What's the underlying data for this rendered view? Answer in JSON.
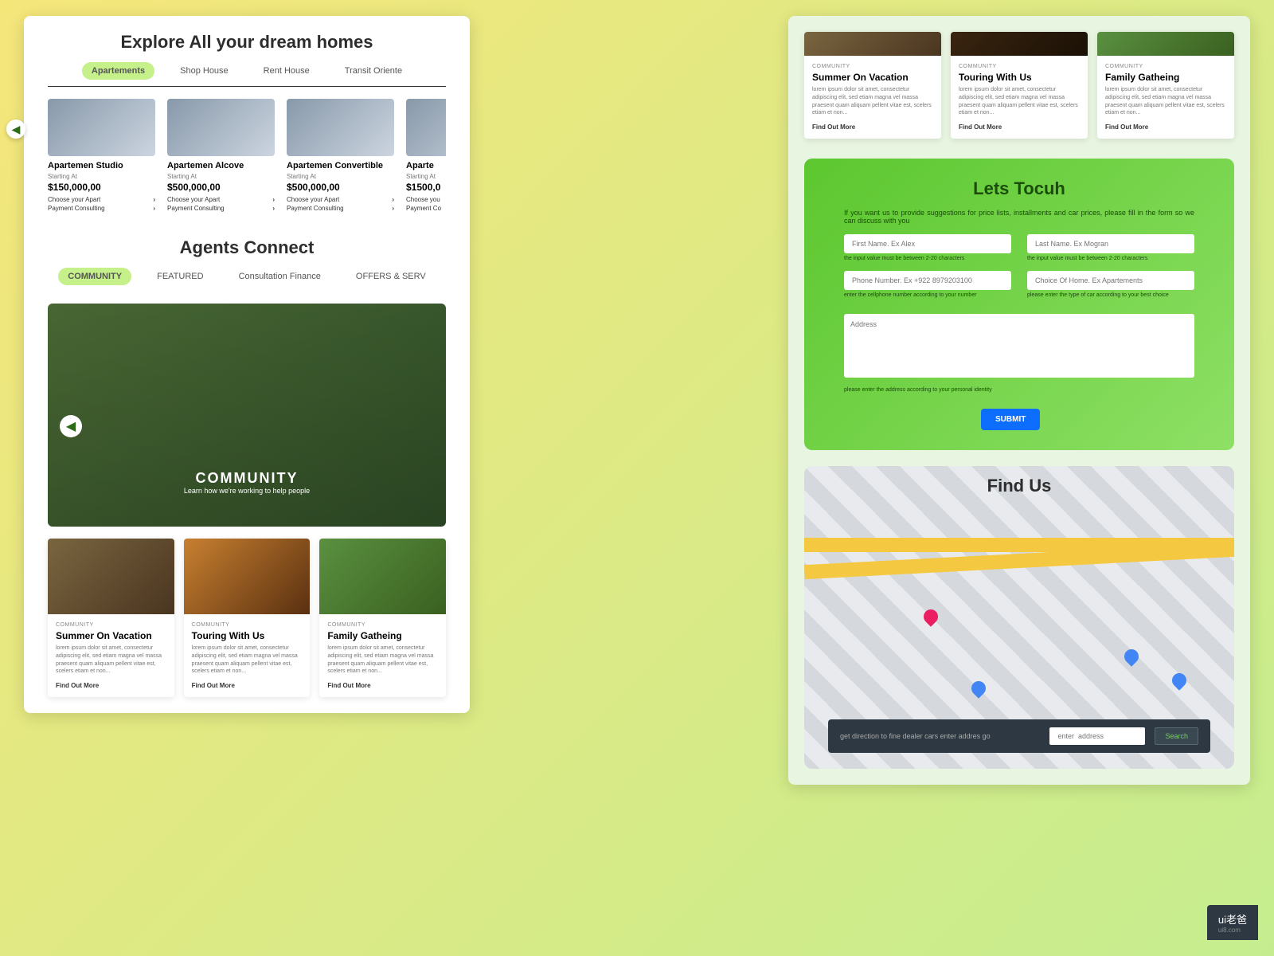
{
  "explore": {
    "title": "Explore All your dream homes",
    "tabs": [
      "Apartements",
      "Shop House",
      "Rent House",
      "Transit Oriente"
    ],
    "listings": [
      {
        "name": "Apartemen Studio",
        "starting": "Starting At",
        "price": "$150,000,00",
        "link1": "Choose your Apart",
        "link2": "Payment Consulting"
      },
      {
        "name": "Apartemen Alcove",
        "starting": "Starting At",
        "price": "$500,000,00",
        "link1": "Choose your Apart",
        "link2": "Payment Consulting"
      },
      {
        "name": "Apartemen Convertible",
        "starting": "Starting At",
        "price": "$500,000,00",
        "link1": "Choose your Apart",
        "link2": "Payment Consulting"
      },
      {
        "name": "Aparte",
        "starting": "Starting At",
        "price": "$1500,0",
        "link1": "Choose you",
        "link2": "Payment Co"
      }
    ]
  },
  "agents": {
    "title": "Agents Connect",
    "tabs": [
      "COMMUNITY",
      "FEATURED",
      "Consultation Finance",
      "OFFERS & SERV"
    ],
    "hero": {
      "title": "COMMUNITY",
      "sub": "Learn how we're working to help people"
    }
  },
  "cards": [
    {
      "tag": "COMMUNITY",
      "title": "Summer On Vacation",
      "desc": "lorem ipsum dolor sit amet, consectetur adipiscing elit, sed etiam magna vel massa praesent quam aliquam pellent vitae est, scelers etiam et non...",
      "link": "Find Out More"
    },
    {
      "tag": "COMMUNITY",
      "title": "Touring With Us",
      "desc": "lorem ipsum dolor sit amet, consectetur adipiscing elit, sed etiam magna vel massa praesent quam aliquam pellent vitae est, scelers etiam et non...",
      "link": "Find Out More"
    },
    {
      "tag": "COMMUNITY",
      "title": "Family Gatheing",
      "desc": "lorem ipsum dolor sit amet, consectetur adipiscing elit, sed etiam magna vel massa praesent quam aliquam pellent vitae est, scelers etiam et non...",
      "link": "Find Out More"
    }
  ],
  "form": {
    "title": "Lets Tocuh",
    "intro": "If you want us to provide suggestions for price lists, installments and car prices, please fill in the form so we can discuss with you",
    "fname_ph": "First Name. Ex Alex",
    "lname_ph": "Last Name. Ex Mogran",
    "hint_name": "the input value must be between 2-20 characters",
    "phone_ph": "Phone Number. Ex +922 8979203100",
    "hint_phone": "enter the cellphone number according to your number",
    "choice_ph": "Choice Of Home. Ex Apartements",
    "hint_choice": "please enter the type of car according to your best choice",
    "addr_ph": "Address",
    "hint_addr": "please enter the address according to your personal identity",
    "submit": "SUBMIT"
  },
  "map": {
    "title": "Find Us",
    "prompt": "get direction to fine dealer cars enter addres  go",
    "input_ph": "enter  address",
    "btn": "Search"
  },
  "watermark": {
    "brand": "ui老爸",
    "url": "ui8.com"
  }
}
